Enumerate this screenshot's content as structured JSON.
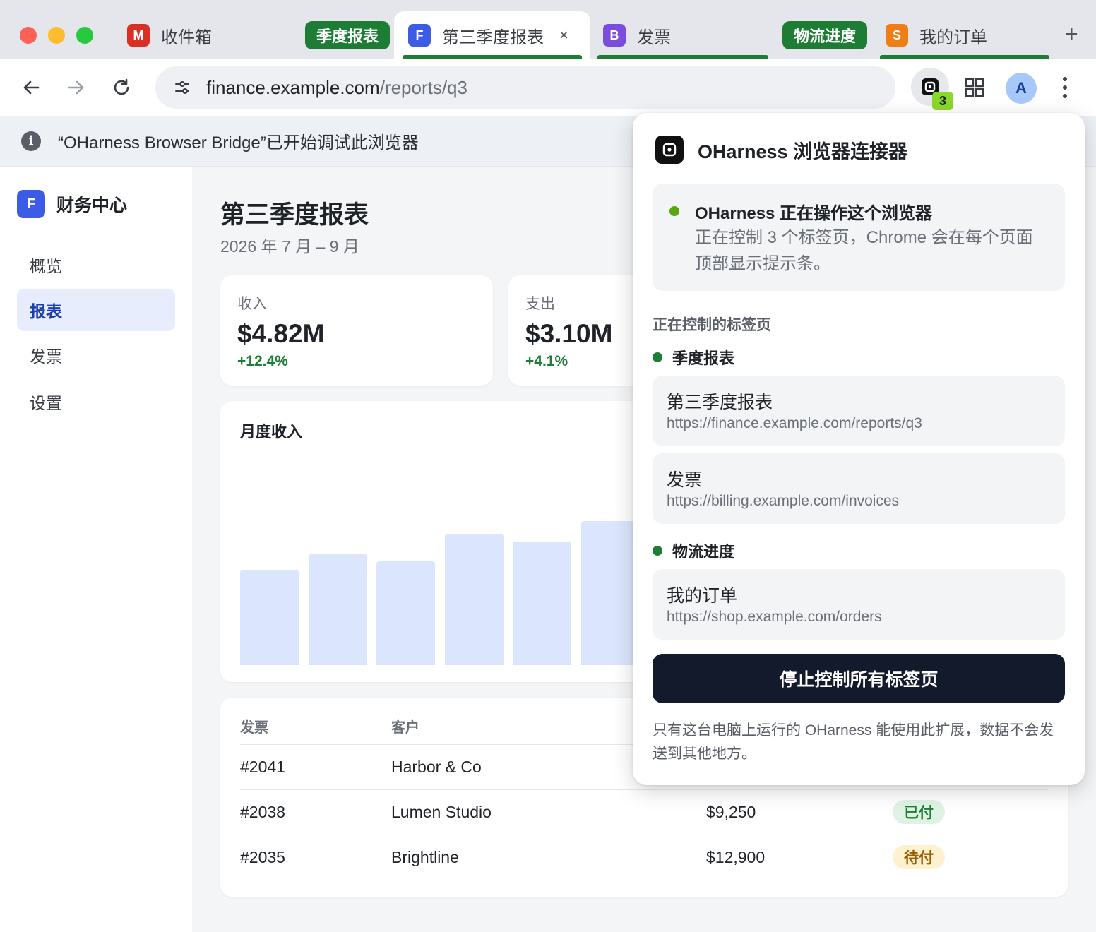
{
  "browser": {
    "tabs": [
      {
        "favicon": "M",
        "favicon_color": "#d93025",
        "title": "收件箱"
      },
      {
        "favicon": "F",
        "favicon_color": "#3d5ce6",
        "title": "第三季度报表",
        "active": true
      },
      {
        "favicon": "B",
        "favicon_color": "#7c4ddc",
        "title": "发票"
      },
      {
        "favicon": "S",
        "favicon_color": "#f07d16",
        "title": "我的订单"
      }
    ],
    "tab_groups": [
      {
        "label": "季度报表",
        "color": "#1e7d34"
      },
      {
        "label": "物流进度",
        "color": "#1e7d34"
      }
    ],
    "close_glyph": "×",
    "new_tab_glyph": "+",
    "address": {
      "host": "finance.example.com",
      "path": "/reports/q3"
    },
    "extension_badge": "3",
    "profile_initial": "A",
    "infobar_icon": "i",
    "infobar_text": "“OHarness Browser Bridge”已开始调试此浏览器"
  },
  "app": {
    "brand_logo": "F",
    "brand_name": "财务中心",
    "nav": [
      {
        "label": "概览",
        "active": false
      },
      {
        "label": "报表",
        "active": true
      },
      {
        "label": "发票",
        "active": false
      },
      {
        "label": "设置",
        "active": false
      }
    ],
    "title": "第三季度报表",
    "subtitle": "2026 年 7 月 – 9 月",
    "kpis": [
      {
        "label": "收入",
        "value": "$4.82M",
        "delta": "+12.4%"
      },
      {
        "label": "支出",
        "value": "$3.10M",
        "delta": "+4.1%"
      }
    ],
    "chart_title": "月度收入",
    "chart_data": {
      "type": "bar",
      "title": "月度收入",
      "values": [
        0.66,
        0.77,
        0.72,
        0.91,
        0.86,
        1.0
      ],
      "value_scale": "relative bar heights (no axis labels shown)",
      "bar_color": "#dbe5fd"
    },
    "table": {
      "columns": [
        "发票",
        "客户"
      ],
      "rows": [
        {
          "id": "#2041",
          "customer": "Harbor & Co",
          "amount": "",
          "status": ""
        },
        {
          "id": "#2038",
          "customer": "Lumen Studio",
          "amount": "$9,250",
          "status": "已付",
          "status_kind": "paid"
        },
        {
          "id": "#2035",
          "customer": "Brightline",
          "amount": "$12,900",
          "status": "待付",
          "status_kind": "pending"
        }
      ]
    }
  },
  "popup": {
    "title": "OHarness 浏览器连接器",
    "status_title": "OHarness 正在操作这个浏览器",
    "status_desc": "正在控制 3 个标签页，Chrome 会在每个页面顶部显示提示条。",
    "section_label": "正在控制的标签页",
    "groups": [
      {
        "name": "季度报表",
        "tabs": [
          {
            "title": "第三季度报表",
            "url": "https://finance.example.com/reports/q3"
          },
          {
            "title": "发票",
            "url": "https://billing.example.com/invoices"
          }
        ]
      },
      {
        "name": "物流进度",
        "tabs": [
          {
            "title": "我的订单",
            "url": "https://shop.example.com/orders"
          }
        ]
      }
    ],
    "stop_button": "停止控制所有标签页",
    "footer": "只有这台电脑上运行的 OHarness 能使用此扩展，数据不会发送到其他地方。",
    "status_color": "#5aa512"
  }
}
